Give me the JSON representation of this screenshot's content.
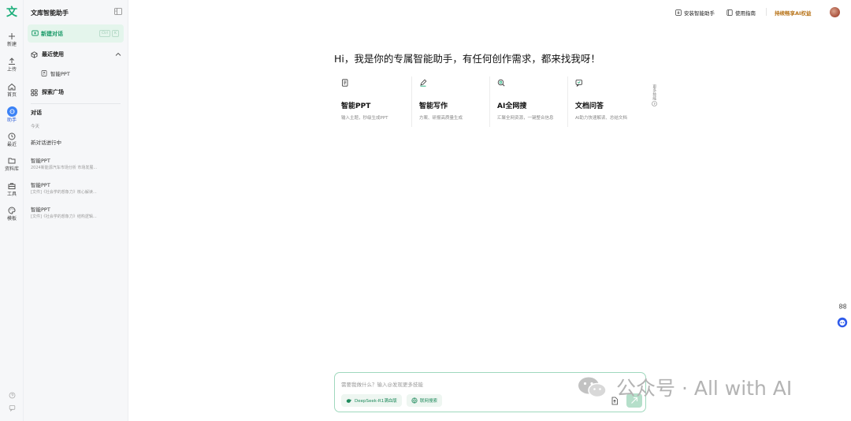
{
  "rail": {
    "logo": "文",
    "items": [
      {
        "label": "新建",
        "icon": "plus-icon"
      },
      {
        "label": "上传",
        "icon": "upload-icon"
      },
      {
        "label": "首页",
        "icon": "home-icon"
      },
      {
        "label": "助手",
        "icon": "assistant-icon"
      },
      {
        "label": "最近",
        "icon": "clock-icon"
      },
      {
        "label": "资料库",
        "icon": "folder-icon"
      },
      {
        "label": "工具",
        "icon": "toolbox-icon"
      },
      {
        "label": "模板",
        "icon": "palette-icon"
      }
    ]
  },
  "sidebar": {
    "title": "文库智能助手",
    "new_chat": {
      "label": "新建对话",
      "kbd": [
        "Ctrl",
        "K"
      ]
    },
    "recent_label": "最近使用",
    "recent_items": [
      {
        "label": "智能PPT"
      }
    ],
    "explore_label": "探索广场",
    "conversations_label": "对话",
    "today_label": "今天",
    "in_progress": "新对话进行中",
    "conversations": [
      {
        "title": "智能PPT",
        "preview": "2024新能源汽车市场分析 市场发展..."
      },
      {
        "title": "智能PPT",
        "preview": "[文件]《社会学的想象力》核心解读..."
      },
      {
        "title": "智能PPT",
        "preview": "[文件]《社会学的想象力》结构逻辑..."
      }
    ]
  },
  "topbar": {
    "install": "安装智能助手",
    "guide": "使用指南",
    "vip": "持续畅享AI权益"
  },
  "main": {
    "greeting": "Hi，我是你的专属智能助手，有任何创作需求，都来找我呀！",
    "cards": [
      {
        "title": "智能PPT",
        "desc": "输入主题，秒级生成PPT",
        "icon": "ppt-icon"
      },
      {
        "title": "智能写作",
        "desc": "方案、研报高质量生成",
        "icon": "pen-icon"
      },
      {
        "title": "AI全网搜",
        "desc": "汇聚全网资源，一键整合信息",
        "icon": "search-icon"
      },
      {
        "title": "文档问答",
        "desc": "AI助力快速解读、总结文档",
        "icon": "chat-icon"
      }
    ],
    "more_label": "更多技能"
  },
  "input": {
    "placeholder": "需要我做什么？输入@发现更多技能",
    "deepseek_label": "DeepSeek-R1满血版",
    "web_search_label": "联网搜索"
  },
  "watermark": {
    "text": "公众号 · All with AI"
  },
  "colors": {
    "brand": "#1bae7a",
    "new_chat_bg": "#e4f5ec",
    "vip": "#b8741a",
    "active_assistant": "#3b82f6"
  }
}
